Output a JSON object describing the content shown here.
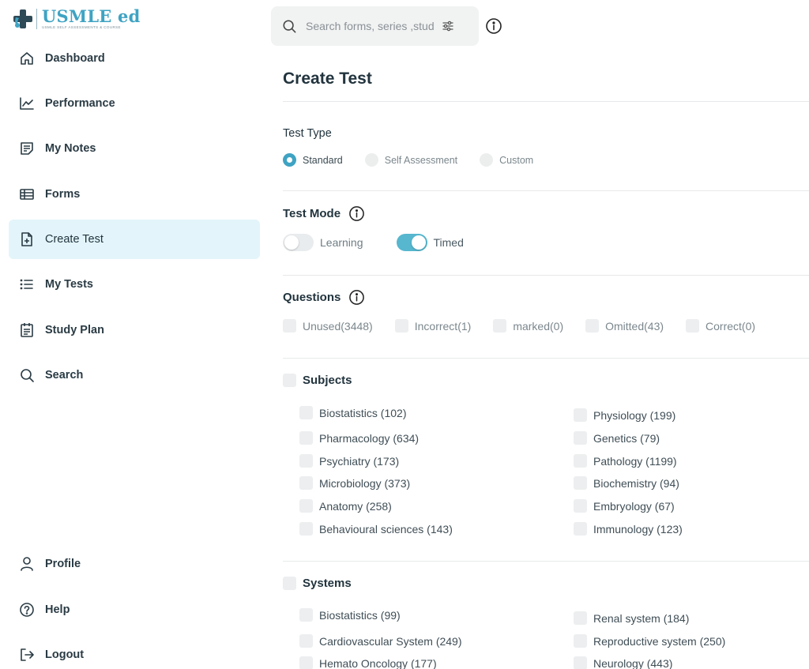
{
  "brand": {
    "title": "USMLE ed",
    "subtitle": "USMLE SELF ASSESSMENTS & COURSE"
  },
  "sidebar": {
    "items": [
      {
        "label": "Dashboard",
        "icon": "home-icon"
      },
      {
        "label": "Performance",
        "icon": "chart-line-icon"
      },
      {
        "label": "My Notes",
        "icon": "notes-icon"
      },
      {
        "label": "Forms",
        "icon": "table-icon"
      },
      {
        "label": "Create Test",
        "icon": "file-plus-icon",
        "active": true
      },
      {
        "label": "My Tests",
        "icon": "list-icon"
      },
      {
        "label": "Study Plan",
        "icon": "clipboard-icon"
      },
      {
        "label": "Search",
        "icon": "search-icon"
      }
    ],
    "bottom": [
      {
        "label": "Profile",
        "icon": "user-icon"
      },
      {
        "label": "Help",
        "icon": "help-icon"
      },
      {
        "label": "Logout",
        "icon": "logout-icon"
      }
    ]
  },
  "search": {
    "placeholder": "Search forms, series ,studies"
  },
  "page": {
    "title": "Create Test"
  },
  "test_type": {
    "title": "Test Type",
    "options": [
      {
        "label": "Standard",
        "selected": true
      },
      {
        "label": "Self Assessment",
        "selected": false
      },
      {
        "label": "Custom",
        "selected": false
      }
    ]
  },
  "test_mode": {
    "title": "Test Mode",
    "options": [
      {
        "label": "Learning",
        "on": false
      },
      {
        "label": "Timed",
        "on": true
      }
    ]
  },
  "questions": {
    "title": "Questions",
    "options": [
      "Unused(3448)",
      "Incorrect(1)",
      "marked(0)",
      "Omitted(43)",
      "Correct(0)"
    ]
  },
  "subjects": {
    "title": "Subjects",
    "left": [
      "Biostatistics (102)",
      "Pharmacology (634)",
      "Psychiatry (173)",
      "Microbiology (373)",
      "Anatomy (258)",
      "Behavioural sciences (143)"
    ],
    "right": [
      "Physiology (199)",
      "Genetics (79)",
      "Pathology (1199)",
      "Biochemistry (94)",
      "Embryology (67)",
      "Immunology (123)"
    ]
  },
  "systems": {
    "title": "Systems",
    "left": [
      "Biostatistics (99)",
      "Cardiovascular System (249)",
      "Hemato Oncology (177)"
    ],
    "right": [
      "Renal system (184)",
      "Reproductive system (250)",
      "Neurology (443)"
    ]
  },
  "colors": {
    "accent": "#3fa3c3",
    "active_bg": "#e3f5fa",
    "toggle_on": "#56b7cf"
  }
}
